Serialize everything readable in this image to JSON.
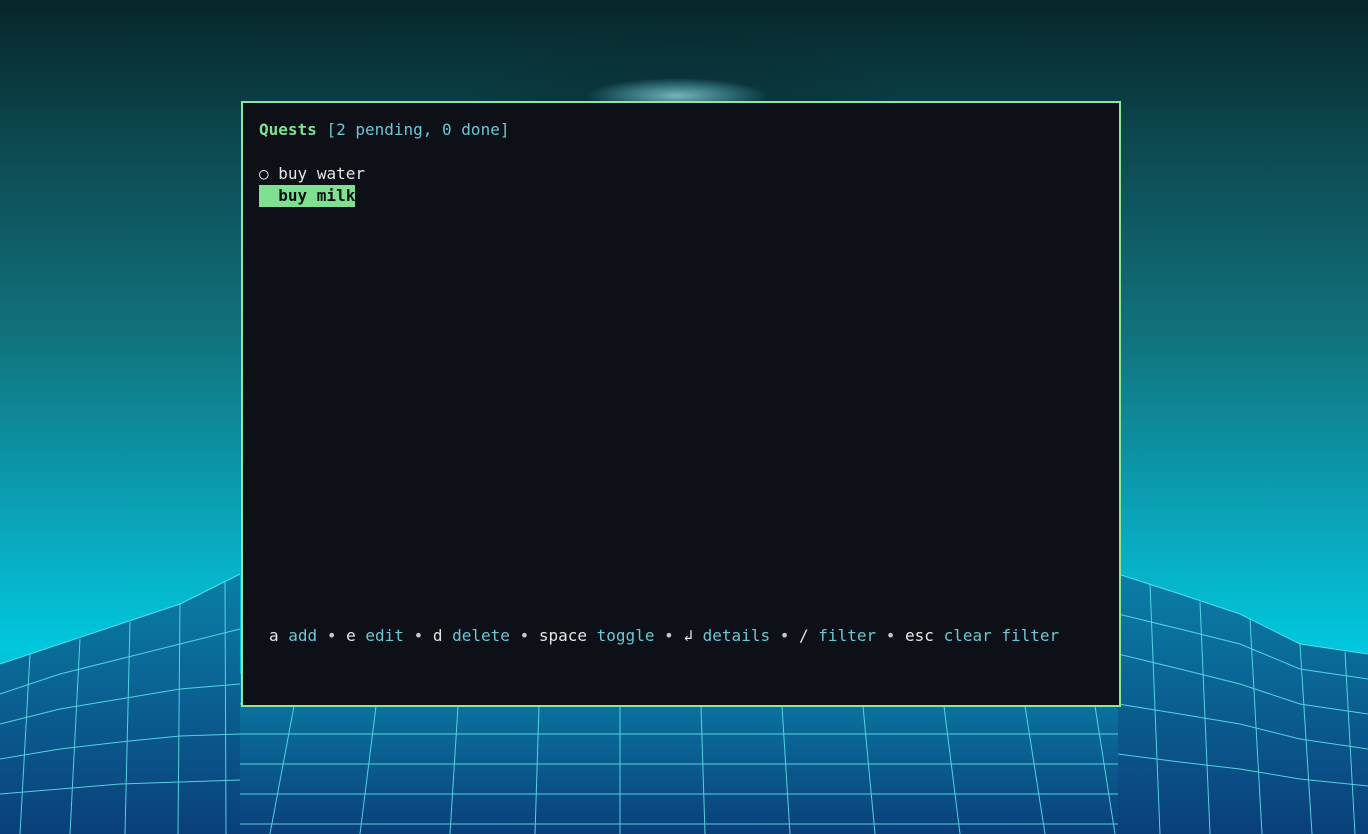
{
  "terminal": {
    "title": "Quests",
    "status": "[2 pending, 0 done]",
    "border_color": "#8ee69a",
    "accent_color": "#7fe08f"
  },
  "quests": [
    {
      "marker": "○",
      "label": "buy water",
      "selected": false
    },
    {
      "marker": "",
      "label": "buy milk",
      "selected": true
    }
  ],
  "help": [
    {
      "key": "a",
      "action": "add"
    },
    {
      "key": "e",
      "action": "edit"
    },
    {
      "key": "d",
      "action": "delete"
    },
    {
      "key": "space",
      "action": "toggle"
    },
    {
      "key": "↲",
      "action": "details"
    },
    {
      "key": "/",
      "action": "filter"
    },
    {
      "key": "esc",
      "action": "clear filter"
    }
  ],
  "separator": "•"
}
